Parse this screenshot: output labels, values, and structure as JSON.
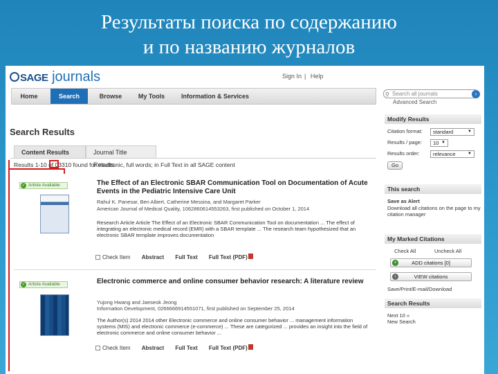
{
  "slide": {
    "title_line1": "Результаты поиска по содержанию",
    "title_line2": "и по названию журналов"
  },
  "header": {
    "logo_sage": "SAGE",
    "logo_journals": "journals",
    "toplinks": [
      "Sign In",
      "Help"
    ],
    "search_placeholder": "Search all journals",
    "advanced_search": "Advanced Search"
  },
  "nav": {
    "items": [
      {
        "label": "Home",
        "active": false
      },
      {
        "label": "Search",
        "active": true
      },
      {
        "label": "Browse",
        "active": false
      },
      {
        "label": "My Tools",
        "active": false
      },
      {
        "label": "Information & Services",
        "active": false
      }
    ]
  },
  "main": {
    "heading": "Search Results",
    "tabs": [
      "Content Results",
      "Journal Title Results"
    ],
    "count_text": "Results 1-10 of 03310 found for electronic, full words; in Full Text in all SAGE content",
    "results": [
      {
        "availability": "Article Available",
        "title": "The Effect of an Electronic SBAR Communication Tool on Documentation of Acute Events in the Pediatric Intensive Care Unit",
        "authors": "Rahul K. Panesar, Ben Albert, Catherine Messina, and Margaret Parker",
        "source": "American Journal of Medical Quality, 1062860614553263, first published on October 1, 2014",
        "abstract": "Research Article Article The Effect of an Electronic SBAR Communication Tool on documentation ... The effect of integrating an electronic medical record (EMR) with a SBAR template ... The research team hypothesized that an electronic SBAR template improves documentation",
        "check_item": "Check Item",
        "links": [
          "Abstract",
          "Full Text",
          "Full Text (PDF)"
        ]
      },
      {
        "availability": "Article Available",
        "title": "Electronic commerce and online consumer behavior research: A literature review",
        "authors": "Yujong Hwang and Jaeseok Jeong",
        "source": "Information Development, 0266666914551071, first published on September 25, 2014",
        "abstract": "The Author(s) 2014 2014 other Electronic commerce and online consumer behavior ... management information systems (MIS) and electronic commerce (e-commerce) ... These are categorized ... provides an insight into the field of electronic commerce and online consumer behavior ...",
        "check_item": "Check Item",
        "links": [
          "Abstract",
          "Full Text",
          "Full Text (PDF)"
        ]
      }
    ]
  },
  "sidebar": {
    "modify": {
      "heading": "Modify Results",
      "rows": [
        {
          "label": "Citation format:",
          "value": "standard"
        },
        {
          "label": "Results / page:",
          "value": "10"
        },
        {
          "label": "Results order:",
          "value": "relevance"
        }
      ],
      "go": "Go"
    },
    "this_search": {
      "heading": "This search",
      "link": "Save as Alert",
      "text": "Download all citations on the page to my citation manager"
    },
    "marked": {
      "heading": "My Marked Citations",
      "check_all": "Check All",
      "uncheck_all": "Uncheck All",
      "add_btn": "ADD citations [0]",
      "view_btn": "VIEW citations",
      "footer": "Save/Print/E-mail/Download"
    },
    "search_results": {
      "heading": "Search Results",
      "next": "Next 10 »",
      "new_search": "New Search"
    }
  }
}
